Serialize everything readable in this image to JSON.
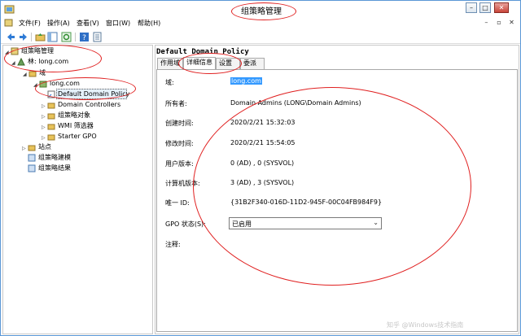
{
  "window": {
    "title": "组策略管理"
  },
  "titlebar_buttons": {
    "minimize": "–",
    "maximize": "□",
    "close": "✕"
  },
  "menubar": {
    "items": [
      "文件(F)",
      "操作(A)",
      "查看(V)",
      "窗口(W)",
      "帮助(H)"
    ],
    "mdi_buttons": [
      "–",
      "▫",
      "✕"
    ]
  },
  "toolbar": {
    "icons": [
      "back-icon",
      "forward-icon",
      "folder-up-icon",
      "show-hide-tree-icon",
      "refresh-icon",
      "help-icon",
      "properties-icon"
    ]
  },
  "tree": {
    "root": "组策略管理",
    "forest": "林: long.com",
    "domains": "域",
    "domain": "long.com",
    "selected": "Default Domain Policy",
    "children": [
      "Domain Controllers",
      "组策略对象",
      "WMI 筛选器",
      "Starter GPO"
    ],
    "sites": "站点",
    "modeling": "组策略建模",
    "results": "组策略结果"
  },
  "panel": {
    "title": "Default Domain Policy",
    "tabs": [
      "作用域",
      "详细信息",
      "设置",
      "委派"
    ],
    "active_tab": 1
  },
  "details": {
    "domain_label": "域:",
    "domain_value": "long.com",
    "owner_label": "所有者:",
    "owner_value": "Domain Admins (LONG\\Domain Admins)",
    "created_label": "创建时间:",
    "created_value": "2020/2/21 15:32:03",
    "modified_label": "修改时间:",
    "modified_value": "2020/2/21 15:54:05",
    "user_version_label": "用户版本:",
    "user_version_value": "0 (AD) , 0 (SYSVOL)",
    "computer_version_label": "计算机版本:",
    "computer_version_value": "3 (AD) , 3 (SYSVOL)",
    "unique_id_label": "唯一 ID:",
    "unique_id_value": "{31B2F340-016D-11D2-945F-00C04FB984F9}",
    "gpo_status_label": "GPO 状态(S):",
    "gpo_status_value": "已启用",
    "comment_label": "注释:"
  },
  "watermark": "知乎 @Windows技术指南",
  "colors": {
    "selection": "#3399ff",
    "annotation": "#e02020",
    "border": "#5a97d6"
  }
}
